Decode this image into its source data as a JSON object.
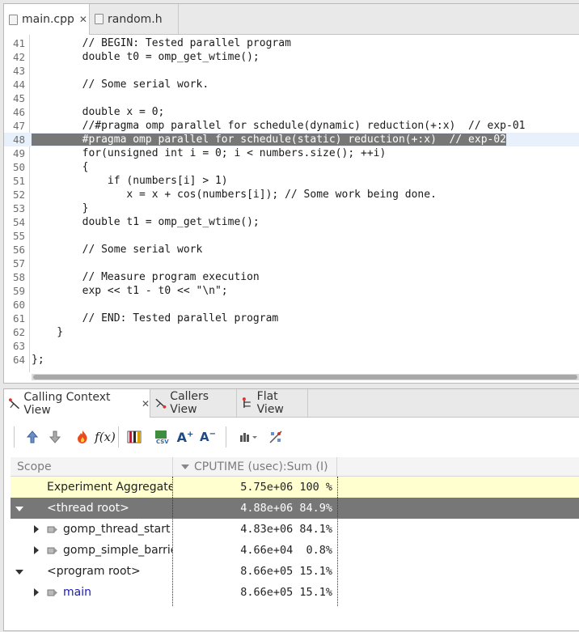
{
  "editor": {
    "tabs": [
      {
        "label": "main.cpp",
        "active": true,
        "closable": true,
        "icon": "cpp-file-icon"
      },
      {
        "label": "random.h",
        "active": false,
        "closable": false,
        "icon": "header-file-icon"
      }
    ],
    "lines": [
      {
        "n": "41",
        "text": "        // BEGIN: Tested parallel program"
      },
      {
        "n": "42",
        "text": "        double t0 = omp_get_wtime();"
      },
      {
        "n": "43",
        "text": ""
      },
      {
        "n": "44",
        "text": "        // Some serial work."
      },
      {
        "n": "45",
        "text": ""
      },
      {
        "n": "46",
        "text": "        double x = 0;"
      },
      {
        "n": "47",
        "text": "        //#pragma omp parallel for schedule(dynamic) reduction(+:x)  // exp-01"
      },
      {
        "n": "48",
        "text": "        #pragma omp parallel for schedule(static) reduction(+:x)  // exp-02",
        "highlight": true
      },
      {
        "n": "49",
        "text": "        for(unsigned int i = 0; i < numbers.size(); ++i)"
      },
      {
        "n": "50",
        "text": "        {"
      },
      {
        "n": "51",
        "text": "            if (numbers[i] > 1)"
      },
      {
        "n": "52",
        "text": "               x = x + cos(numbers[i]); // Some work being done."
      },
      {
        "n": "53",
        "text": "        }"
      },
      {
        "n": "54",
        "text": "        double t1 = omp_get_wtime();"
      },
      {
        "n": "55",
        "text": ""
      },
      {
        "n": "56",
        "text": "        // Some serial work"
      },
      {
        "n": "57",
        "text": ""
      },
      {
        "n": "58",
        "text": "        // Measure program execution"
      },
      {
        "n": "59",
        "text": "        exp << t1 - t0 << \"\\n\";"
      },
      {
        "n": "60",
        "text": ""
      },
      {
        "n": "61",
        "text": "        // END: Tested parallel program"
      },
      {
        "n": "62",
        "text": "    }"
      },
      {
        "n": "63",
        "text": ""
      },
      {
        "n": "64",
        "text": "};"
      }
    ]
  },
  "views": {
    "tabs": [
      {
        "label": "Calling Context View",
        "active": true,
        "closable": true,
        "icon": "calling-context-icon"
      },
      {
        "label": "Callers View",
        "active": false,
        "icon": "callers-icon"
      },
      {
        "label": "Flat View",
        "active": false,
        "icon": "flat-view-icon"
      }
    ],
    "toolbar": [
      "zoom-in-icon",
      "zoom-out-icon",
      "hot-path-icon",
      "derived-metric-icon",
      "column-select-icon",
      "export-csv-icon",
      "font-increase-icon",
      "font-decrease-icon",
      "graph-icon",
      "thread-view-icon"
    ],
    "columns": {
      "scope": "Scope",
      "metric": "CPUTIME (usec):Sum (I)"
    },
    "rows": [
      {
        "scope": "Experiment Aggregate Metrics",
        "value": "5.75e+06",
        "percent": "100 %",
        "type": "aggregate"
      },
      {
        "scope": "<thread root>",
        "value": "4.88e+06",
        "percent": "84.9%",
        "type": "root",
        "expanded": true,
        "selected": true
      },
      {
        "scope": "gomp_thread_start",
        "value": "4.83e+06",
        "percent": "84.1%",
        "type": "proc",
        "expanded": false
      },
      {
        "scope": "gomp_simple_barrier_wait",
        "value": "4.66e+04",
        "percent": " 0.8%",
        "type": "proc",
        "expanded": false
      },
      {
        "scope": "<program root>",
        "value": "8.66e+05",
        "percent": "15.1%",
        "type": "root",
        "expanded": true
      },
      {
        "scope": "main",
        "value": "8.66e+05",
        "percent": "15.1%",
        "type": "proc",
        "expanded": false,
        "link": true
      }
    ],
    "colors": {
      "aggregate_row": "#ffffd0",
      "selected_row": "#777777",
      "link": "#1a1ab8"
    }
  }
}
